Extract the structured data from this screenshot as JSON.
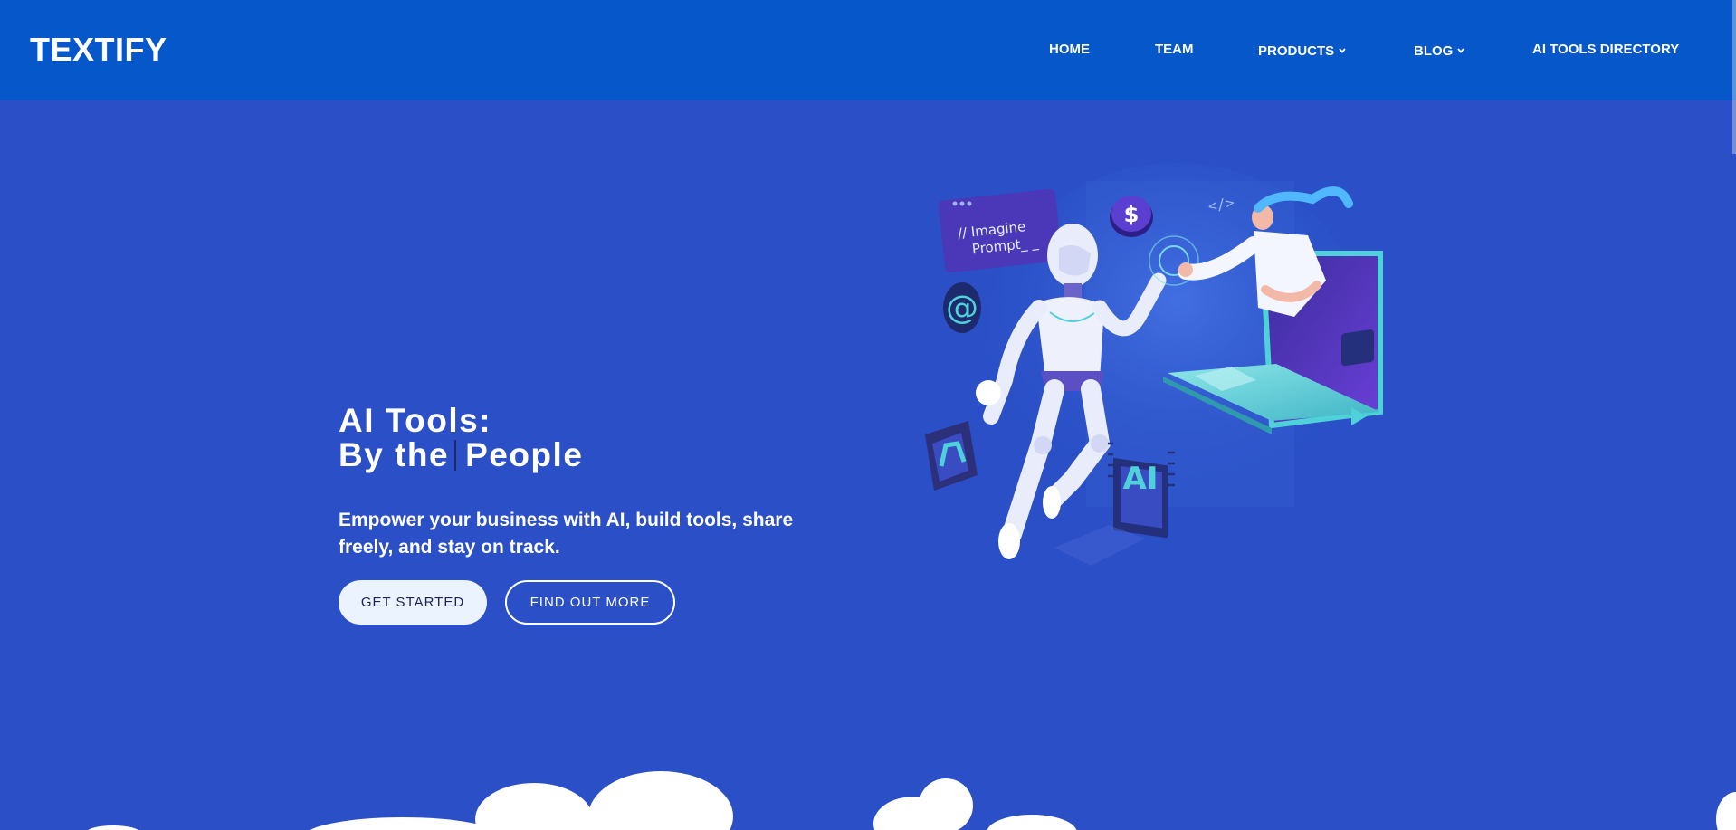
{
  "brand": "TEXTIFY",
  "nav": {
    "home": "HOME",
    "team": "TEAM",
    "products": "PRODUCTS",
    "blog": "BLOG",
    "directory": "AI TOOLS DIRECTORY"
  },
  "hero": {
    "title_line1": "AI Tools:",
    "title_line2a": "By the",
    "title_line2b": "People",
    "subtitle": "Empower your business with AI, build tools, share freely, and stay on track.",
    "primary_button": "GET STARTED",
    "secondary_button": "FIND OUT MORE"
  },
  "illustration": {
    "prompt_line1": "// Imagine",
    "prompt_line2": "Prompt_ _",
    "code_tag": "</>",
    "chip_label": "AI",
    "at_symbol": "@",
    "dollar_symbol": "$"
  },
  "colors": {
    "nav_bg": "#0657c9",
    "hero_bg": "#2a4fc6",
    "primary_button_bg": "#eaf3ff"
  }
}
